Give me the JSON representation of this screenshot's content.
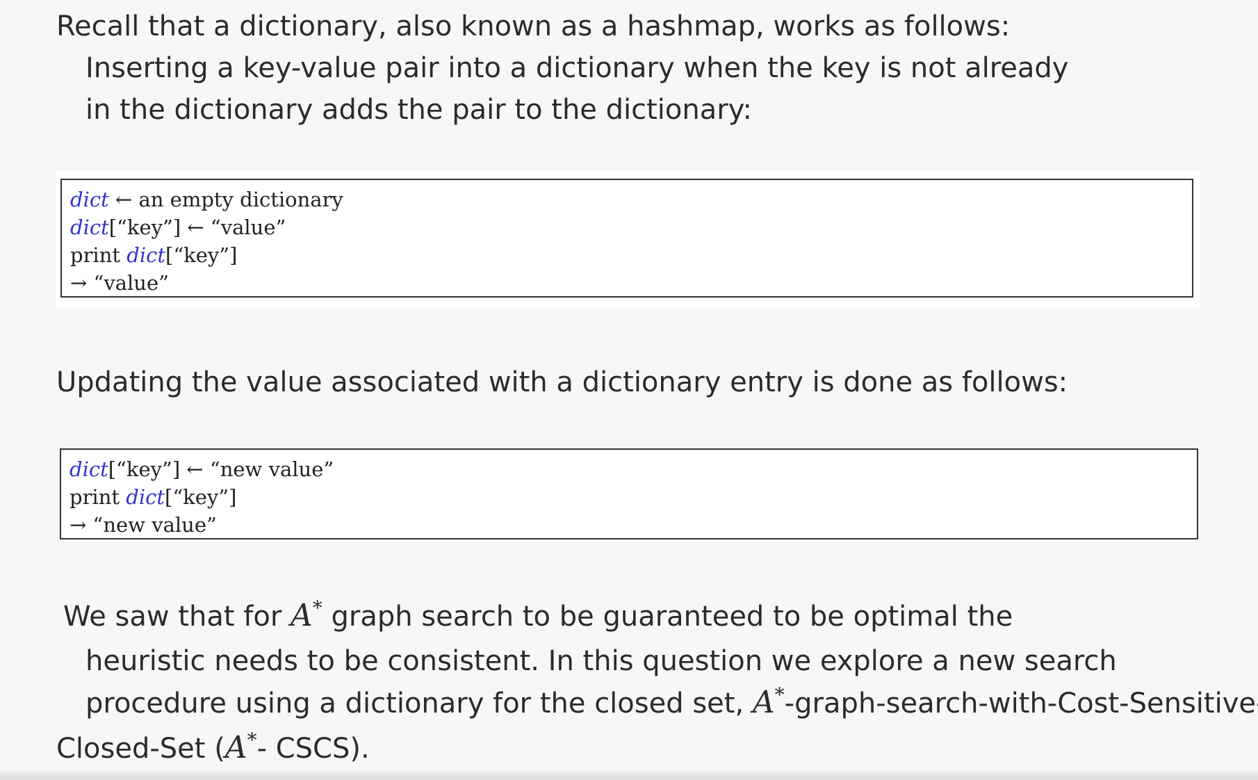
{
  "intro": {
    "line1": "Recall that a dictionary, also known as a hashmap, works as follows:",
    "line2": "Inserting a key-value pair into a dictionary when the key is not already",
    "line3": "in the dictionary adds the pair to the dictionary:"
  },
  "code1": {
    "l1_var": "dict",
    "l1_rest": " ← an empty dictionary",
    "l2_var": "dict",
    "l2_rest": "[“key”] ← “value”",
    "l3_pre": "print ",
    "l3_var": "dict",
    "l3_rest": "[“key”]",
    "l4": "→ “value”"
  },
  "update": {
    "text": "Updating the value associated with a dictionary entry is done as follows:"
  },
  "code2": {
    "l1_var": "dict",
    "l1_rest": "[“key”] ← “new value”",
    "l2_pre": "print ",
    "l2_var": "dict",
    "l2_rest": "[“key”]",
    "l3": "→ “new value”"
  },
  "closing": {
    "l1_pre": "We saw that for ",
    "A": "A",
    "star": "*",
    "l1_post": " graph search to be guaranteed to be optimal the",
    "l2": "heuristic needs to be consistent.  In this question we explore a new search",
    "l3_pre": "procedure using a dictionary for the closed set, ",
    "l3_post": "-graph-search-with-Cost-Sensitive-",
    "l4_pre": "Closed-Set (",
    "l4_post": "- CSCS)."
  }
}
